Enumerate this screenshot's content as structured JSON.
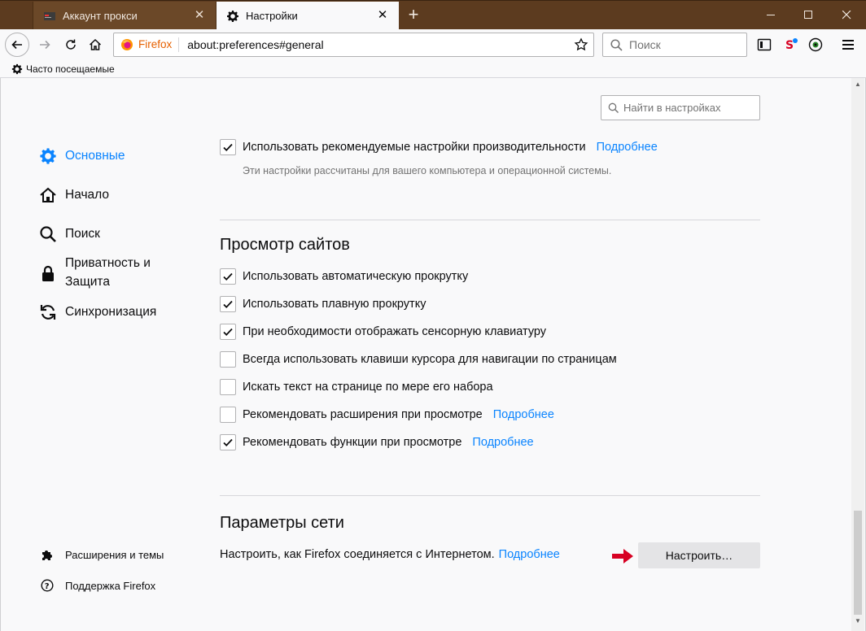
{
  "tabs": [
    {
      "title": "Аккаунт прокси",
      "active": false
    },
    {
      "title": "Настройки",
      "active": true
    }
  ],
  "navbar": {
    "brand": "Firefox",
    "url": "about:preferences#general",
    "search_placeholder": "Поиск"
  },
  "bookmarks": {
    "item": "Часто посещаемые"
  },
  "settings_search": {
    "placeholder": "Найти в настройках"
  },
  "sidebar": {
    "categories": [
      {
        "label": "Основные",
        "icon": "gear-icon",
        "selected": true
      },
      {
        "label": "Начало",
        "icon": "home-icon"
      },
      {
        "label": "Поиск",
        "icon": "search-icon"
      },
      {
        "label_line1": "Приватность и",
        "label_line2": "Защита",
        "icon": "lock-icon"
      },
      {
        "label": "Синхронизация",
        "icon": "sync-icon"
      }
    ],
    "footer": [
      {
        "label": "Расширения и темы",
        "icon": "puzzle-icon"
      },
      {
        "label": "Поддержка Firefox",
        "icon": "help-icon"
      }
    ]
  },
  "performance": {
    "recommended_label": "Использовать рекомендуемые настройки производительности",
    "recommended_checked": true,
    "recommended_link": "Подробнее",
    "recommended_desc": "Эти настройки рассчитаны для вашего компьютера и операционной системы."
  },
  "browsing": {
    "heading": "Просмотр сайтов",
    "options": [
      {
        "label": "Использовать автоматическую прокрутку",
        "checked": true
      },
      {
        "label": "Использовать плавную прокрутку",
        "checked": true
      },
      {
        "label": "При необходимости отображать сенсорную клавиатуру",
        "checked": true
      },
      {
        "label": "Всегда использовать клавиши курсора для навигации по страницам",
        "checked": false
      },
      {
        "label": "Искать текст на странице по мере его набора",
        "checked": false
      },
      {
        "label": "Рекомендовать расширения при просмотре",
        "checked": false,
        "link": "Подробнее"
      },
      {
        "label": "Рекомендовать функции при просмотре",
        "checked": true,
        "link": "Подробнее"
      }
    ]
  },
  "network": {
    "heading": "Параметры сети",
    "text": "Настроить, как Firefox соединяется с Интернетом.",
    "link": "Подробнее",
    "button": "Настроить…"
  },
  "colors": {
    "accent": "#0a84ff",
    "titlebar": "#5c3b1f",
    "arrow": "#d70022"
  }
}
